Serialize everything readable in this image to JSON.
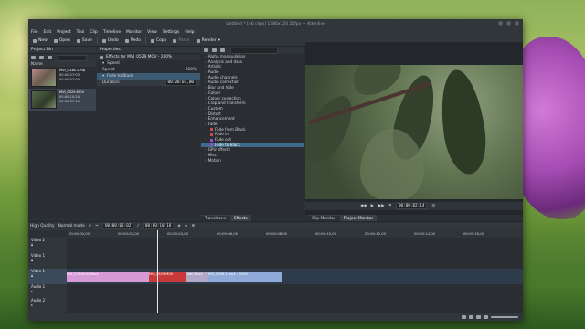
{
  "window": {
    "title": "Untitled * [46 clips] 1280x720 25fps — Kdenlive"
  },
  "menu": [
    "File",
    "Edit",
    "Project",
    "Tool",
    "Clip",
    "Timeline",
    "Monitor",
    "View",
    "Settings",
    "Help"
  ],
  "toolbar": {
    "new": "New",
    "open": "Open",
    "save": "Save",
    "undo": "Undo",
    "redo": "Redo",
    "copy": "Copy",
    "paste": "Paste",
    "render": "Render"
  },
  "project_bin": {
    "title": "Project Bin",
    "column": "Name",
    "clips": [
      {
        "name": "MVI_0338-1.mp",
        "line2": "00:00:27:03",
        "line3": "00:00:02:00"
      },
      {
        "name": "MVI_0529.MOV",
        "line2": "00:00:10:24",
        "line3": "00:00:07:00"
      }
    ]
  },
  "properties": {
    "title": "Properties",
    "header": "Effects for MVI_0529.MOV - 200%",
    "speed_section": "Speed",
    "speed_label": "Speed",
    "speed_value": "200%",
    "effect_name": "Fade to Black",
    "duration_label": "Duration",
    "duration_value": "00:00:01,00"
  },
  "effects_tree": [
    {
      "label": "Alpha manipulation",
      "level": 0
    },
    {
      "label": "Analysis and data",
      "level": 0
    },
    {
      "label": "Artistic",
      "level": 0
    },
    {
      "label": "Audio",
      "level": 0
    },
    {
      "label": "Audio channels",
      "level": 0
    },
    {
      "label": "Audio correction",
      "level": 0
    },
    {
      "label": "Blur and hide",
      "level": 0
    },
    {
      "label": "Colour",
      "level": 0
    },
    {
      "label": "Colour correction",
      "level": 0
    },
    {
      "label": "Crop and transform",
      "level": 0
    },
    {
      "label": "Custom",
      "level": 0
    },
    {
      "label": "Distort",
      "level": 0
    },
    {
      "label": "Enhancement",
      "level": 0
    },
    {
      "label": "Fade",
      "level": 0
    },
    {
      "label": "Fade from Black",
      "level": 1,
      "color": "#d04848"
    },
    {
      "label": "Fade in",
      "level": 1,
      "color": "#d04848"
    },
    {
      "label": "Fade out",
      "level": 1,
      "color": "#9a4ad0"
    },
    {
      "label": "Fade to Black",
      "level": 1,
      "color": "#9a4ad0",
      "selected": true
    },
    {
      "label": "GPU effects",
      "level": 0
    },
    {
      "label": "Misc",
      "level": 0
    },
    {
      "label": "Motion",
      "level": 0
    }
  ],
  "dock_tabs": {
    "transitions": "Transitions",
    "effects": "Effects",
    "clip_monitor": "Clip Monitor",
    "project_monitor": "Project Monitor"
  },
  "monitor": {
    "timecode": "00:00:02:14"
  },
  "timeline": {
    "quality": "High Quality",
    "mode": "Normal mode",
    "position": "00:00:05:02",
    "duration": "00:00:10:18",
    "ruler": [
      "00:00:00,00",
      "00:00:02,00",
      "00:00:04,00",
      "00:00:06,00",
      "00:00:08,00",
      "00:00:10,00",
      "00:00:12,00",
      "00:00:14,00",
      "00:00:16,00"
    ],
    "tracks": [
      {
        "name": "Video 2"
      },
      {
        "name": "Video 1"
      },
      {
        "name": "Video 1"
      },
      {
        "name": "Audio 1"
      },
      {
        "name": "Audio 2"
      }
    ],
    "clips": [
      "MVI_0 Fade to Black",
      "MVI_0529.MOV",
      "Fade Black",
      "MVI_0338-1.mp4 - 200%"
    ]
  },
  "colors": {
    "accent": "#3d6b8c",
    "clip_pink": "#d89ad6",
    "clip_red": "#c83a3a",
    "clip_blue": "#8fa9d8"
  }
}
